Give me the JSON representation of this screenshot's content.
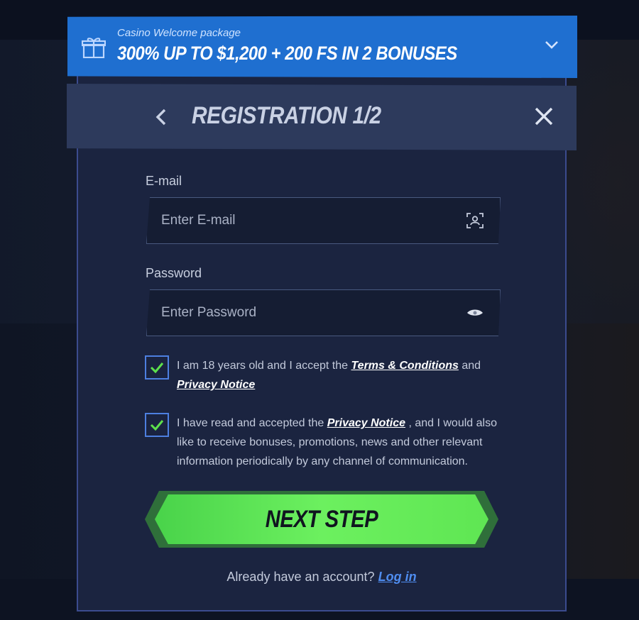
{
  "promo": {
    "subtitle": "Casino Welcome package",
    "title": "300% UP TO $1,200 + 200 FS IN 2 BONUSES"
  },
  "header": {
    "title": "REGISTRATION 1/2"
  },
  "email": {
    "label": "E-mail",
    "placeholder": "Enter E-mail",
    "value": ""
  },
  "password": {
    "label": "Password",
    "placeholder": "Enter Password",
    "value": ""
  },
  "consent_age": {
    "checked": true,
    "text_before": "I am 18 years old and I accept the ",
    "terms_link": "Terms & Conditions",
    "text_mid": " and ",
    "privacy_link": "Privacy Notice"
  },
  "consent_marketing": {
    "checked": true,
    "text_before": "I have read and accepted the ",
    "privacy_link": "Privacy Notice",
    "text_after": " , and I would also like to receive bonuses, promotions, news and other relevant information periodically by any channel of communication."
  },
  "next_button": {
    "label": "NEXT STEP"
  },
  "footer": {
    "text": "Already have an account? ",
    "login_link": "Log in"
  },
  "colors": {
    "promo_bg": "#1f6fd0",
    "header_bg": "#2d3a5c",
    "modal_bg": "#1b2440",
    "checkbox_border": "#4d7fe0",
    "check_mark": "#5de04c",
    "next_button": "#5fe653",
    "link_blue": "#4f8df0"
  },
  "icons": {
    "promo": "gift-icon",
    "expand": "chevron-down-icon",
    "back": "chevron-left-icon",
    "close": "close-icon",
    "email_field": "contact-card-icon",
    "password_field": "eye-icon",
    "checkbox": "checkmark-icon"
  }
}
